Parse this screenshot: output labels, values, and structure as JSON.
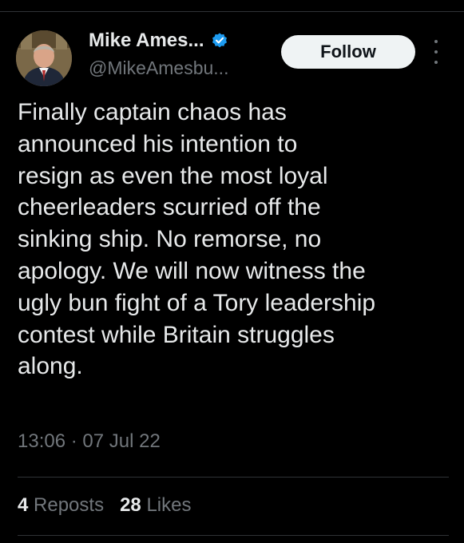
{
  "author": {
    "display_name": "Mike Ames...",
    "handle": "@MikeAmesbu...",
    "verified": true,
    "avatar_icon": "profile-photo"
  },
  "actions": {
    "follow_label": "Follow",
    "more_icon": "more-vertical-icon"
  },
  "tweet": {
    "text": "Finally captain chaos has\nannounced his intention to\nresign as even the most loyal\ncheerleaders scurried off the\nsinking ship. No remorse, no\napology. We will now witness the\nugly bun fight of a Tory leadership\ncontest while Britain struggles\nalong.",
    "time": "13:06",
    "separator": "·",
    "date": "07 Jul 22"
  },
  "stats": {
    "reposts_count": "4",
    "reposts_label": "Reposts",
    "likes_count": "28",
    "likes_label": "Likes"
  },
  "colors": {
    "background": "#000000",
    "text_primary": "#e7e9ea",
    "text_secondary": "#71767b",
    "verified_blue": "#1d9bf0",
    "divider": "#2f3336",
    "follow_bg": "#eff3f4"
  }
}
